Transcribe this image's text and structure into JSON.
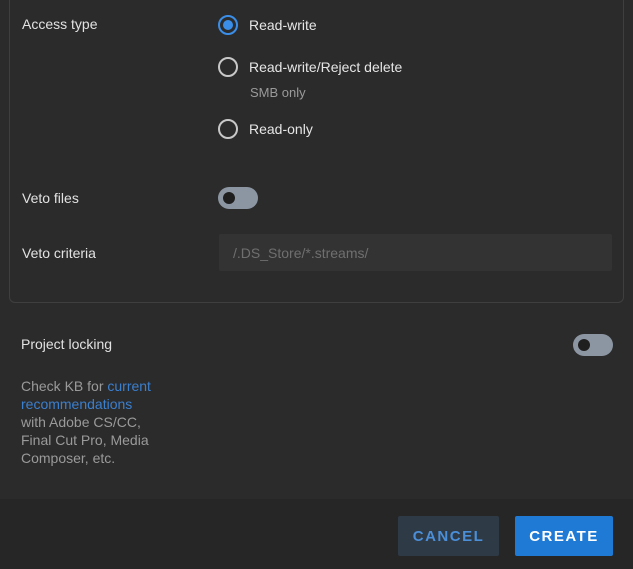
{
  "access": {
    "label": "Access type",
    "options": [
      {
        "label": "Read-write",
        "checked": true
      },
      {
        "label": "Read-write/Reject delete",
        "checked": false,
        "hint": "SMB only"
      },
      {
        "label": "Read-only",
        "checked": false
      }
    ]
  },
  "veto_files": {
    "label": "Veto files",
    "enabled": false
  },
  "veto_criteria": {
    "label": "Veto criteria",
    "value": "",
    "placeholder": "/.DS_Store/*.streams/"
  },
  "project_locking": {
    "label": "Project locking",
    "enabled": false,
    "note_prefix": "Check KB for ",
    "note_link": "current recommendations",
    "note_suffix": " with Adobe CS/CC, Final Cut Pro, Media Composer, etc."
  },
  "footer": {
    "cancel_label": "CANCEL",
    "create_label": "CREATE"
  },
  "colors": {
    "accent": "#3b8ee8",
    "background": "#2b2b2b",
    "link": "#3b7fcf",
    "toggle_off": "#8c96a3"
  }
}
